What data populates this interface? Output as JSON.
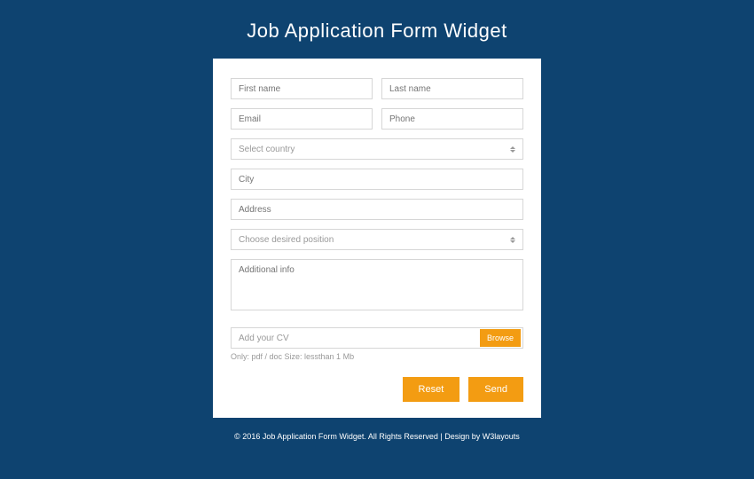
{
  "page": {
    "title": "Job Application Form Widget"
  },
  "form": {
    "first_name": {
      "placeholder": "First name"
    },
    "last_name": {
      "placeholder": "Last name"
    },
    "email": {
      "placeholder": "Email"
    },
    "phone": {
      "placeholder": "Phone"
    },
    "country": {
      "placeholder": "Select country"
    },
    "city": {
      "placeholder": "City"
    },
    "address": {
      "placeholder": "Address"
    },
    "position": {
      "placeholder": "Choose desired position"
    },
    "additional": {
      "placeholder": "Additional info"
    },
    "cv": {
      "placeholder": "Add your CV",
      "browse_label": "Browse",
      "hint": "Only: pdf / doc Size: lessthan 1 Mb"
    },
    "reset_label": "Reset",
    "send_label": "Send"
  },
  "footer": {
    "text": "© 2016 Job Application Form Widget. All Rights Reserved | Design by ",
    "link": "W3layouts"
  }
}
